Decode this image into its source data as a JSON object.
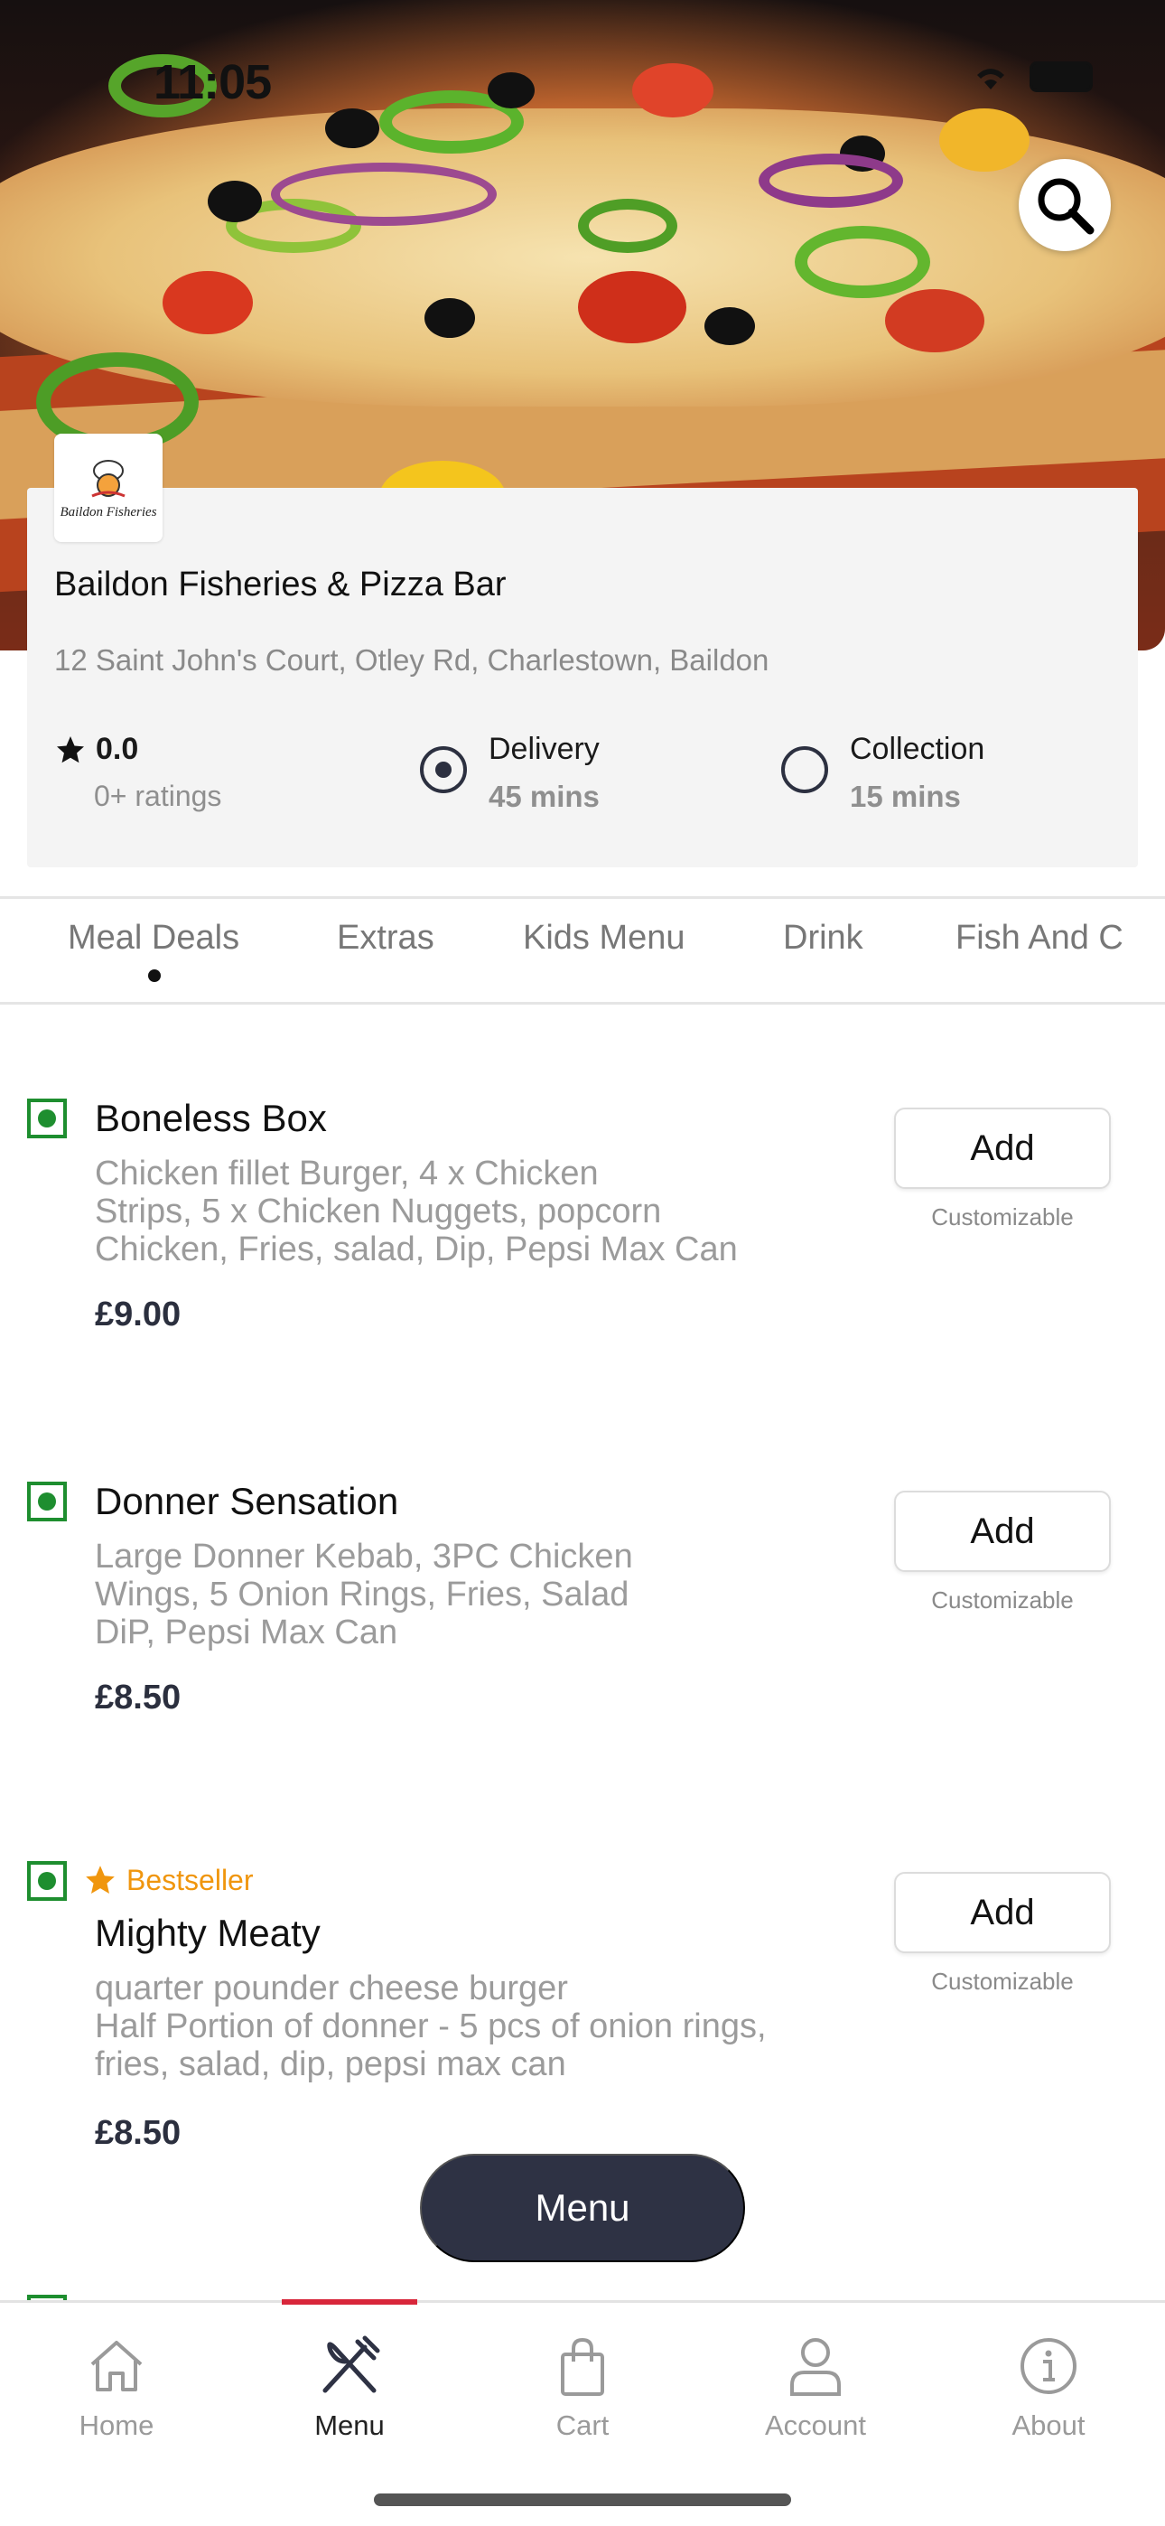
{
  "status_bar": {
    "time": "11:05"
  },
  "restaurant": {
    "logo_text": "Baildon Fisheries",
    "name": "Baildon Fisheries & Pizza Bar",
    "address": "12 Saint John's Court, Otley Rd, Charlestown, Baildon",
    "rating": "0.0",
    "ratings_count": "0+ ratings",
    "delivery_label": "Delivery",
    "delivery_time": "45 mins",
    "collection_label": "Collection",
    "collection_time": "15 mins",
    "selected_mode": "Delivery"
  },
  "tabs": [
    {
      "label": "Meal Deals",
      "active": true
    },
    {
      "label": "Extras"
    },
    {
      "label": "Kids Menu"
    },
    {
      "label": "Drink"
    },
    {
      "label": "Fish And C"
    }
  ],
  "items": [
    {
      "title": "Boneless Box",
      "description": "Chicken fillet Burger, 4 x Chicken\nStrips, 5 x Chicken Nuggets, popcorn\nChicken, Fries, salad, Dip, Pepsi Max Can",
      "price": "£9.00",
      "add_label": "Add",
      "customizable": "Customizable"
    },
    {
      "title": "Donner Sensation",
      "description": "Large Donner Kebab, 3PC Chicken\nWings, 5 Onion Rings, Fries, Salad\nDiP, Pepsi Max Can",
      "price": "£8.50",
      "add_label": "Add",
      "customizable": "Customizable"
    },
    {
      "badge": "Bestseller",
      "title": "Mighty Meaty",
      "description": "quarter pounder cheese burger\nHalf Portion of donner - 5 pcs of onion rings,\nfries, salad, dip, pepsi max can",
      "price": "£8.50",
      "add_label": "Add",
      "customizable": "Customizable"
    }
  ],
  "menu_button": "Menu",
  "bottom_nav": [
    {
      "label": "Home",
      "icon": "home-icon"
    },
    {
      "label": "Menu",
      "icon": "fork-knife-icon",
      "active": true
    },
    {
      "label": "Cart",
      "icon": "shopping-bag-icon"
    },
    {
      "label": "Account",
      "icon": "user-icon"
    },
    {
      "label": "About",
      "icon": "info-icon"
    }
  ],
  "colors": {
    "veg_green": "#1e8e2f",
    "bestseller_orange": "#f0960e",
    "active_nav_red": "#d8263a",
    "fab_dark": "#2e3244"
  }
}
